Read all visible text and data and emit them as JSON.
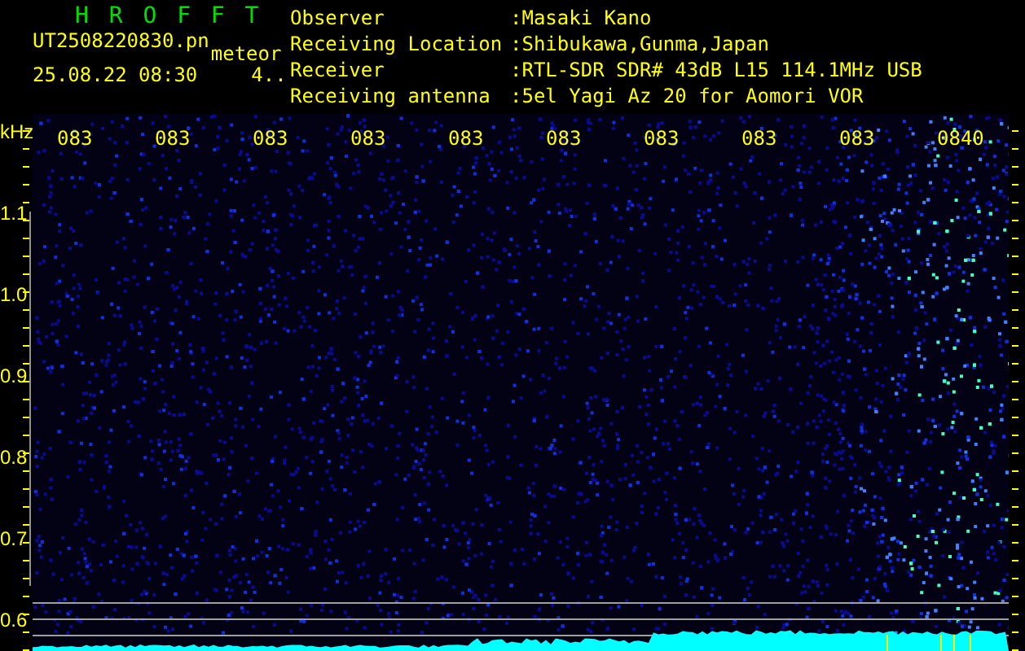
{
  "header": {
    "title": "H R O F F T",
    "file": "UT2508220830.pn",
    "mode": "meteor",
    "datetime": "25.08.22 08:30",
    "count": "4.."
  },
  "info": [
    {
      "label": "Observer",
      "value": ":Masaki Kano"
    },
    {
      "label": "Receiving Location",
      "value": ":Shibukawa,Gunma,Japan"
    },
    {
      "label": "Receiver",
      "value": ":RTL-SDR SDR# 43dB L15 114.1MHz USB"
    },
    {
      "label": "Receiving antenna",
      "value": ":5el Yagi Az 20 for Aomori VOR"
    }
  ],
  "plot": {
    "unit": "kHz",
    "y_labels": [
      "1.1",
      "1.0",
      "0.9",
      "0.8",
      "0.7",
      "0.6"
    ],
    "time_labels": [
      "083",
      "083",
      "083",
      "083",
      "083",
      "083",
      "083",
      "083",
      "083",
      "0840"
    ]
  }
}
